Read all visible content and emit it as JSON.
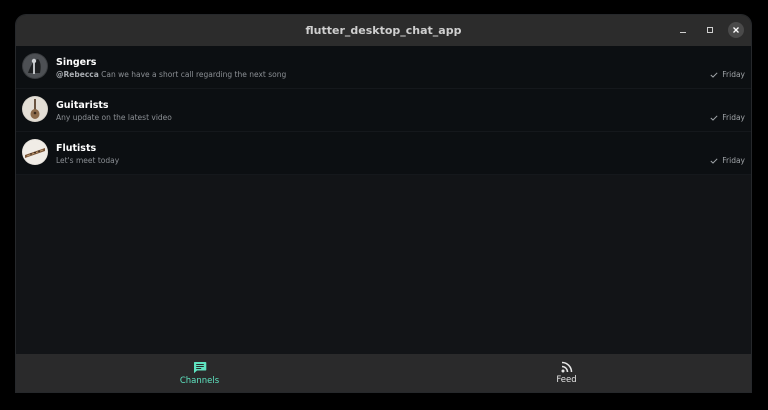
{
  "window": {
    "title": "flutter_desktop_chat_app"
  },
  "channels": [
    {
      "name": "Singers",
      "mention": "@Rebecca",
      "message": " Can we have a short call regarding the next song",
      "time": "Friday",
      "avatar_icon": "singer-photo"
    },
    {
      "name": "Guitarists",
      "mention": "",
      "message": "Any update on the latest video",
      "time": "Friday",
      "avatar_icon": "guitar-photo"
    },
    {
      "name": "Flutists",
      "mention": "",
      "message": "Let's meet today",
      "time": "Friday",
      "avatar_icon": "flute-photo"
    }
  ],
  "bottom_nav": {
    "channels_label": "Channels",
    "feed_label": "Feed",
    "active": "Channels"
  },
  "colors": {
    "accent": "#5fe3c0",
    "background": "#121417",
    "list_background": "#0c0f12",
    "nav_background": "#2a2a2b"
  }
}
